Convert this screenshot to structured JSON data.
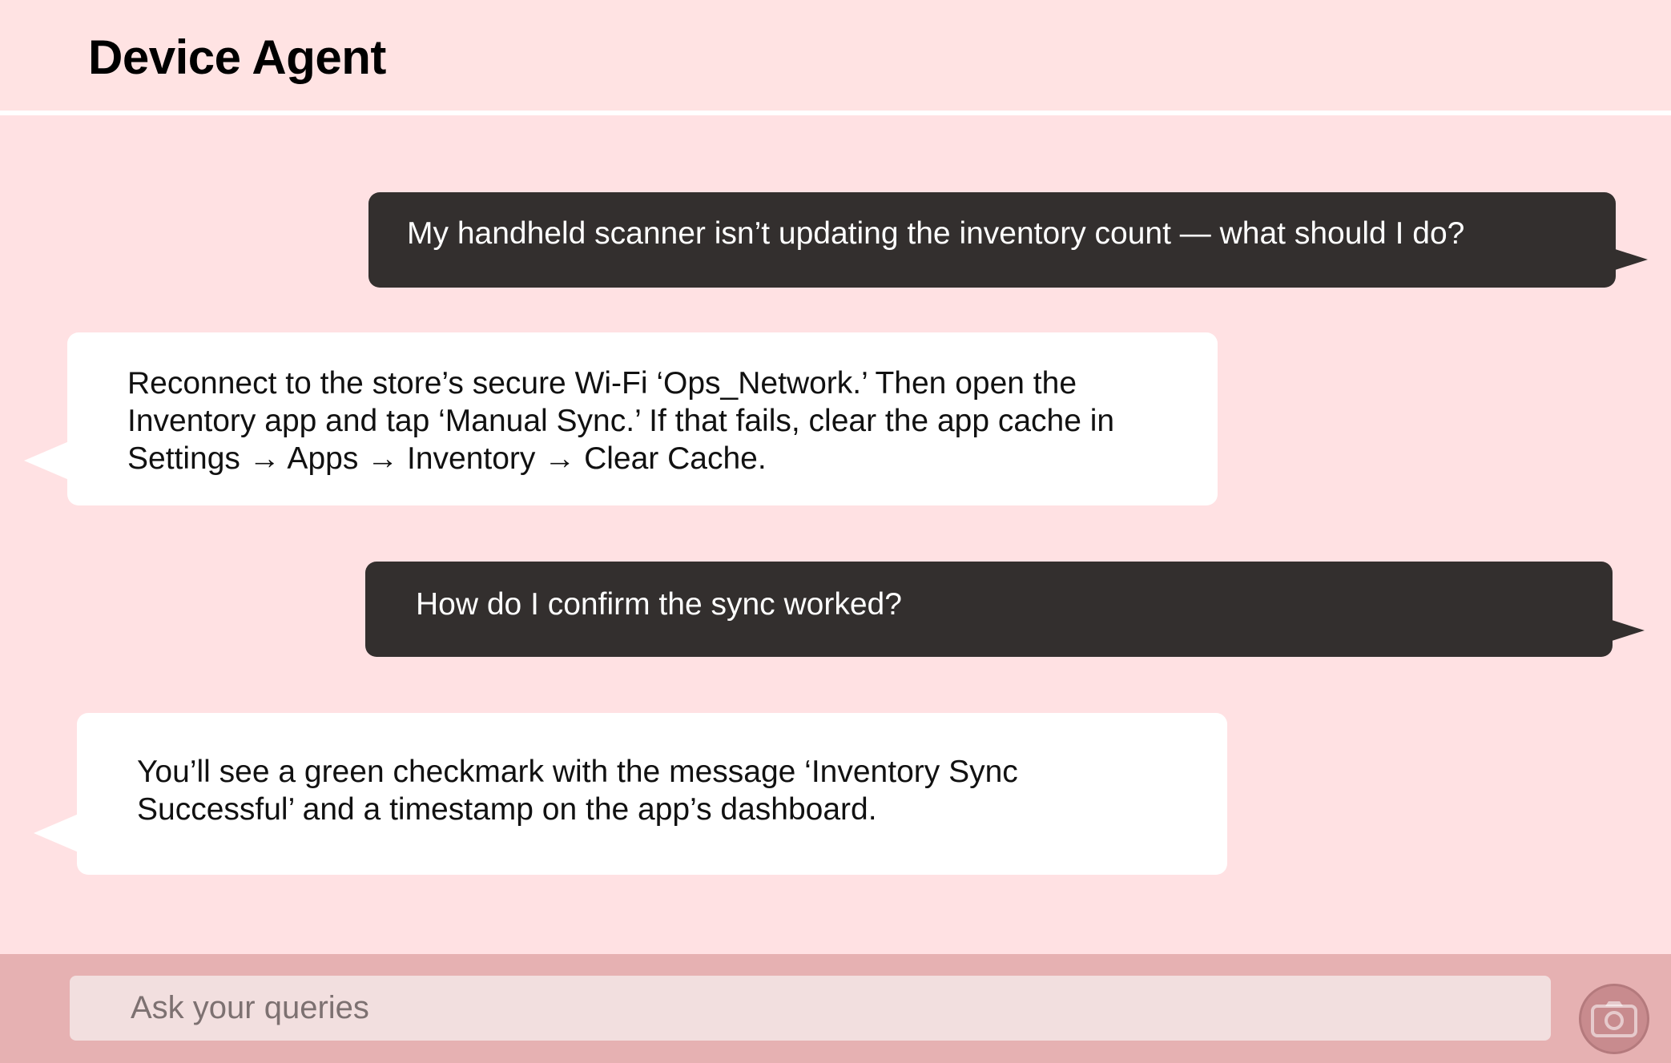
{
  "app": {
    "title": "Device Agent"
  },
  "messages": [
    {
      "role": "user",
      "text": "My handheld scanner isn’t updating the inventory count — what should I do?"
    },
    {
      "role": "agent",
      "text": "Reconnect to the store’s secure Wi-Fi ‘Ops_Network.’ Then open the Inventory app and tap ‘Manual Sync.’ If that fails, clear the app cache in Settings → Apps → Inventory → Clear Cache."
    },
    {
      "role": "user",
      "text": "How do I confirm the sync worked?"
    },
    {
      "role": "agent",
      "text": "You’ll see a green checkmark with the message ‘Inventory Sync Successful’ and a timestamp on the app’s dashboard."
    }
  ],
  "composer": {
    "placeholder": "Ask your queries",
    "value": "",
    "camera_icon": "camera-icon"
  },
  "colors": {
    "page_background": "#ffe3e3",
    "user_bubble": "#332f2e",
    "agent_bubble": "#ffffff",
    "footer_background": "#e6b1b2",
    "input_background": "#f2dfdf",
    "camera_button": "#c88b8e"
  }
}
